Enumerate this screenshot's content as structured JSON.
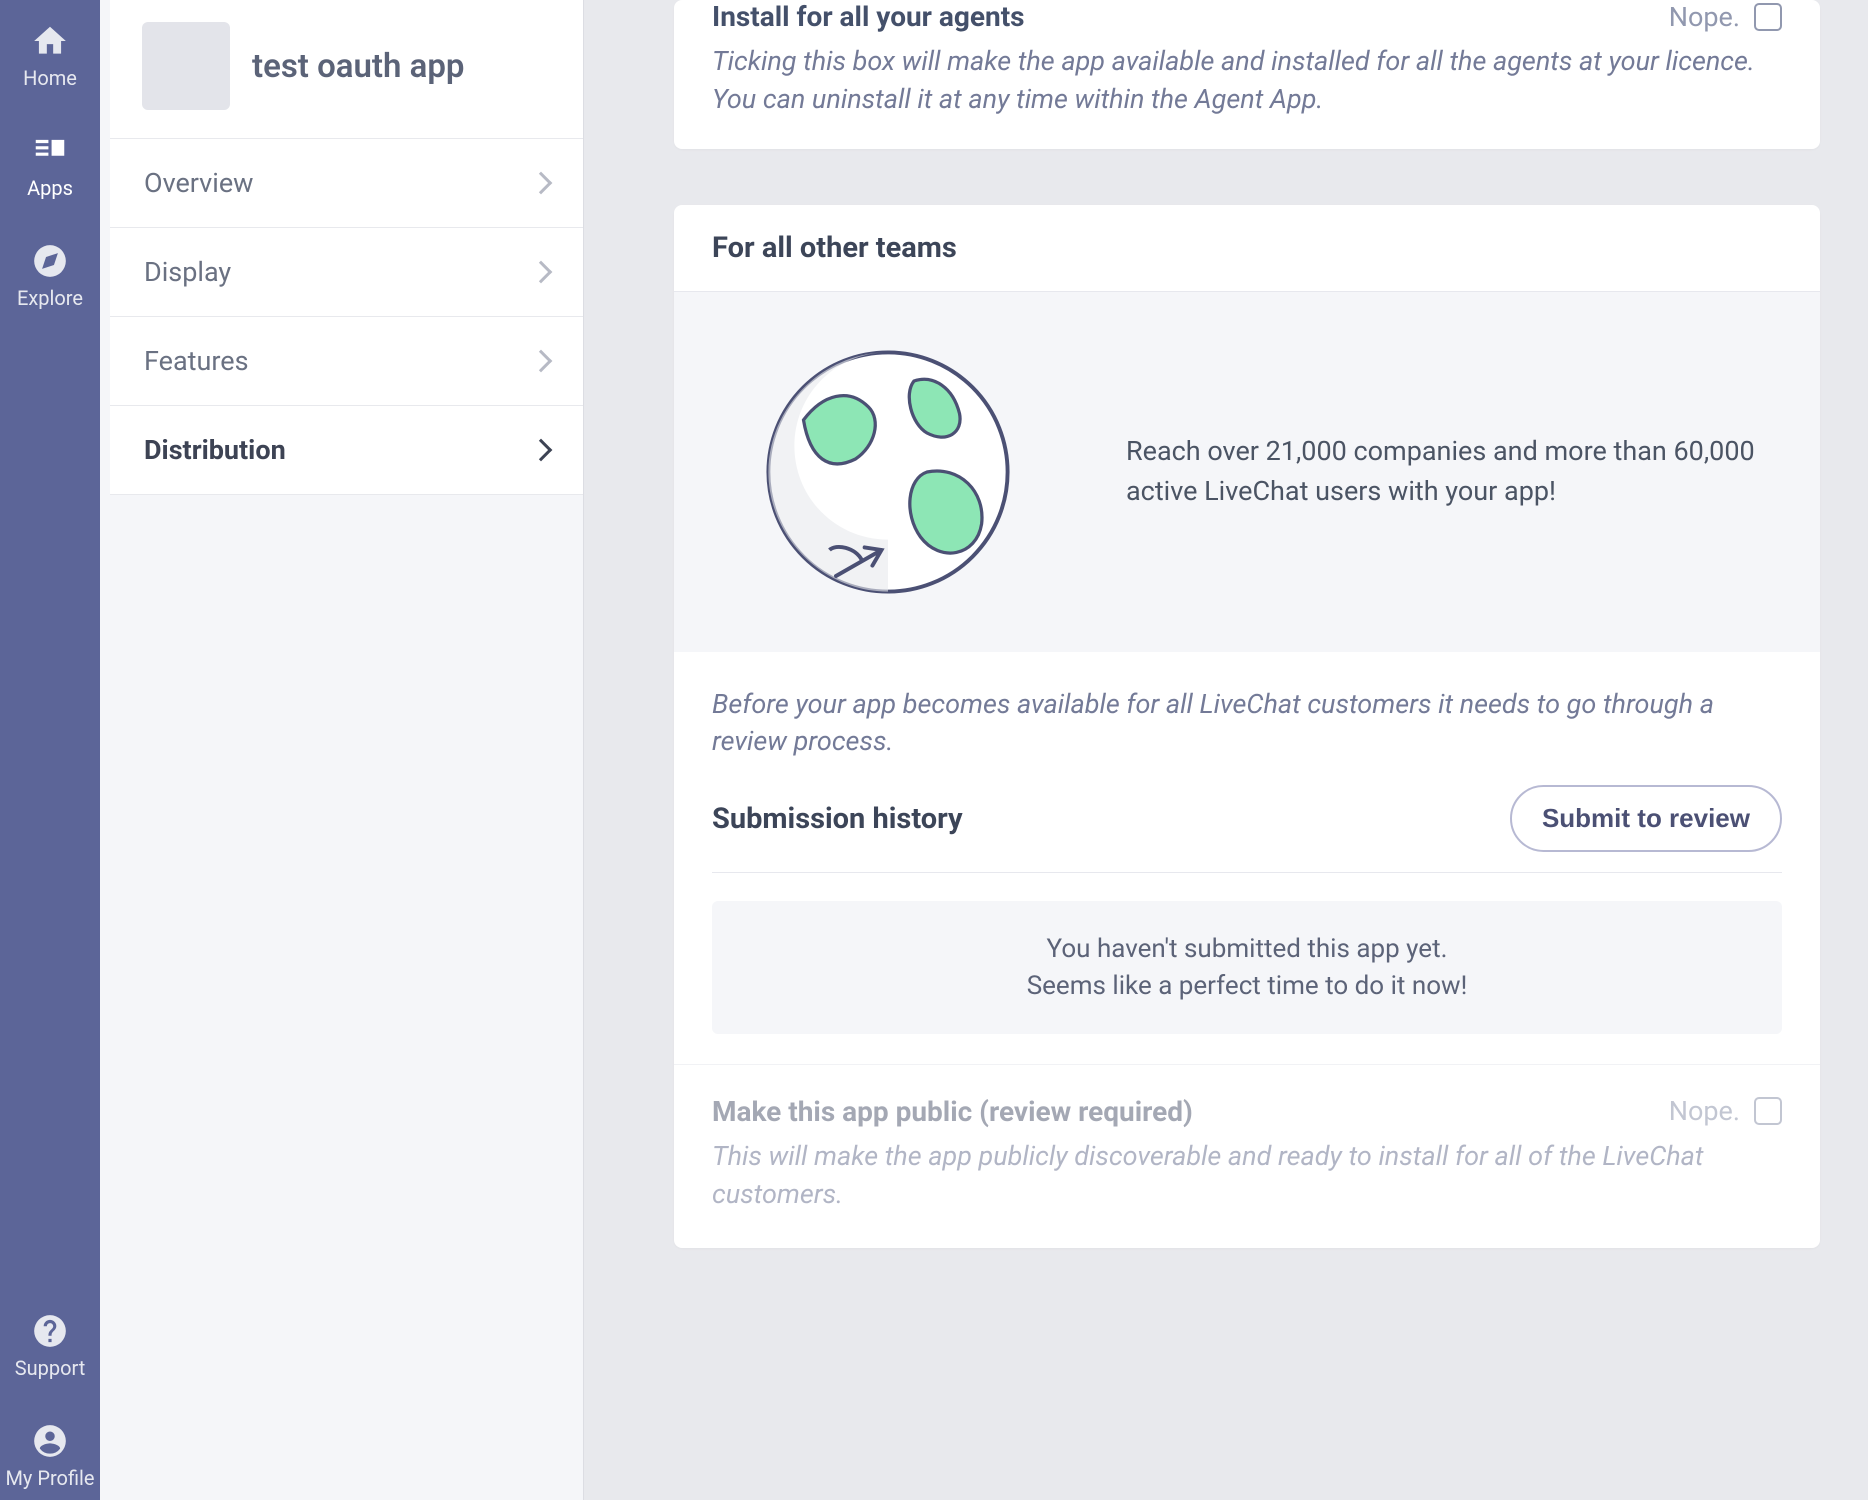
{
  "nav": {
    "home": "Home",
    "apps": "Apps",
    "explore": "Explore",
    "support": "Support",
    "profile": "My Profile"
  },
  "sidebar": {
    "app_name": "test oauth app",
    "items": [
      {
        "label": "Overview"
      },
      {
        "label": "Display"
      },
      {
        "label": "Features"
      },
      {
        "label": "Distribution"
      }
    ]
  },
  "install_card": {
    "title": "Install for all your agents",
    "toggle_label": "Nope.",
    "hint": "Ticking this box will make the app available and installed for all the agents at your licence. You can uninstall it at any time within the Agent App."
  },
  "teams_card": {
    "title": "For all other teams",
    "hero_text": "Reach over 21,000 companies and more than 60,000 active LiveChat users with your app!",
    "review_hint": "Before your app becomes available for all LiveChat customers it needs to go through a review process.",
    "submission_title": "Submission history",
    "submit_button": "Submit to review",
    "empty_line1": "You haven't submitted this app yet.",
    "empty_line2": "Seems like a perfect time to do it now!",
    "public_title": "Make this app public (review required)",
    "public_toggle_label": "Nope.",
    "public_hint": "This will make the app publicly discoverable and ready to install for all of the LiveChat customers."
  }
}
